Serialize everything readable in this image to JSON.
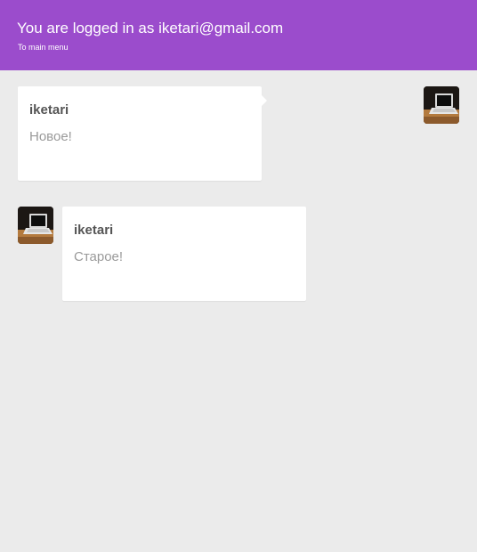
{
  "header": {
    "title": "You are logged in as iketari@gmail.com",
    "menu_link": "To main menu",
    "background_color": "#9b4ccc"
  },
  "messages": [
    {
      "author": "iketari",
      "text": "Новое!",
      "side": "own",
      "avatar_icon": "laptop-photo-icon"
    },
    {
      "author": "iketari",
      "text": "Старое!",
      "side": "other",
      "avatar_icon": "laptop-photo-icon"
    }
  ],
  "colors": {
    "page_background": "#ebebeb",
    "bubble_background": "#ffffff",
    "author_text": "#555555",
    "message_text": "#9a9a9a"
  }
}
